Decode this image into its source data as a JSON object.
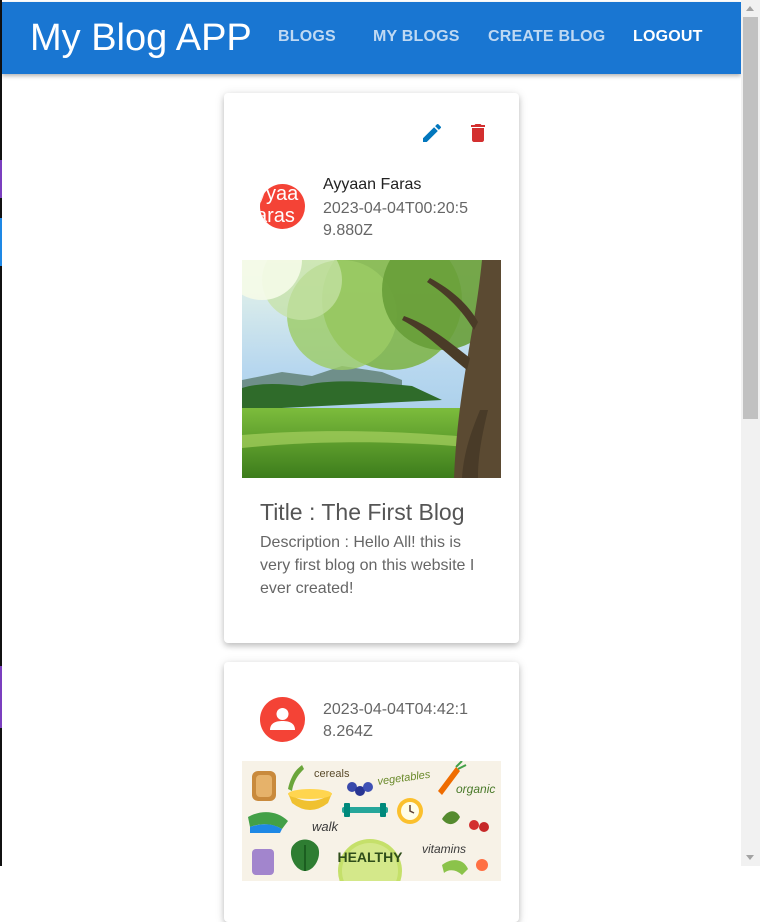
{
  "app": {
    "brand": "My Blog APP",
    "nav": [
      {
        "label": "BLOGS"
      },
      {
        "label": "MY BLOGS"
      },
      {
        "label": "CREATE BLOG"
      },
      {
        "label": "LOGOUT"
      }
    ]
  },
  "colors": {
    "appbar": "#1976d2",
    "edit_icon": "#0277bd",
    "delete_icon": "#d32f2f",
    "avatar": "#f44336"
  },
  "blogs": [
    {
      "author": "Ayyaan Faras",
      "avatar_text": "yyaa\naras",
      "date": "2023-04-04T00:20:59.880Z",
      "title": "Title : The First Blog",
      "description": "Description : Hello All! this is very first blog on this website I ever created!",
      "image": "tree-landscape-photo",
      "actions": [
        "edit-icon",
        "delete-icon"
      ]
    },
    {
      "avatar_icon": "person-icon",
      "date": "2023-04-04T04:42:18.264Z",
      "image": "healthy-food-illustration",
      "image_words": [
        "cereals",
        "vegetables",
        "organic",
        "walk",
        "vitamins",
        "HEALTHY"
      ]
    }
  ]
}
